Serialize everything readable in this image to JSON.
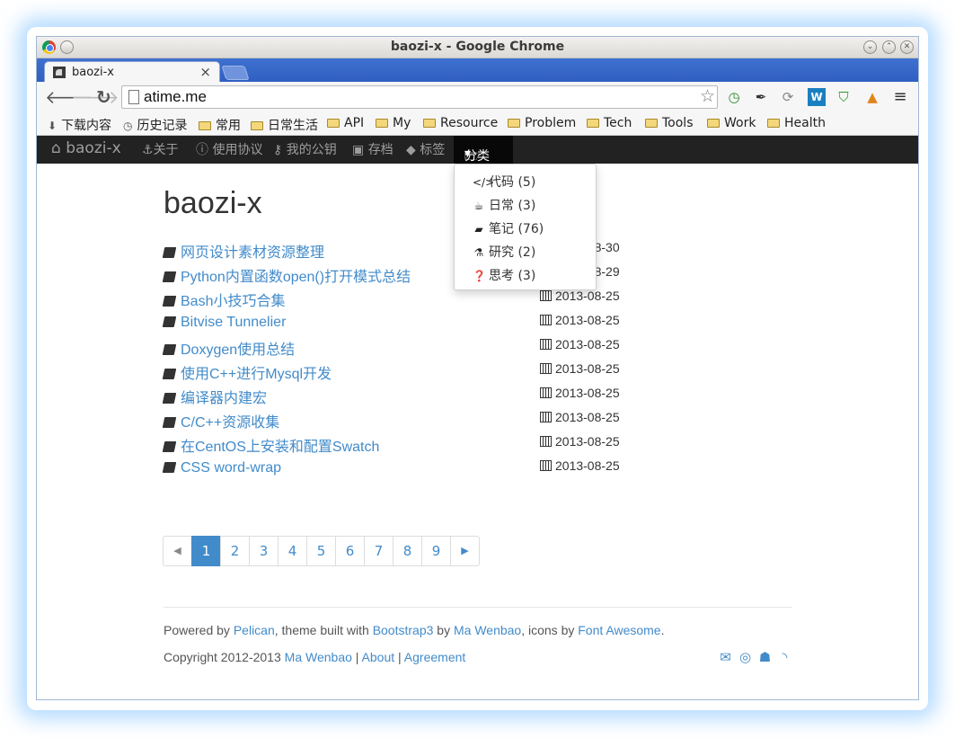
{
  "window": {
    "title": "baozi-x - Google Chrome"
  },
  "tab": {
    "label": "baozi-x",
    "close": "×"
  },
  "address_bar": {
    "url": "atime.me"
  },
  "bookmarks": [
    {
      "label": "下载内容",
      "icon": "download-icon"
    },
    {
      "label": "历史记录",
      "icon": "history-icon"
    },
    {
      "label": "常用",
      "icon": "folder-icon"
    },
    {
      "label": "日常生活",
      "icon": "folder-icon"
    },
    {
      "label": "API",
      "icon": "folder-icon"
    },
    {
      "label": "My",
      "icon": "folder-icon"
    },
    {
      "label": "Resource",
      "icon": "folder-icon"
    },
    {
      "label": "Problem",
      "icon": "folder-icon"
    },
    {
      "label": "Tech",
      "icon": "folder-icon"
    },
    {
      "label": "Tools",
      "icon": "folder-icon"
    },
    {
      "label": "Work",
      "icon": "folder-icon"
    },
    {
      "label": "Health",
      "icon": "folder-icon"
    }
  ],
  "site_nav": {
    "brand": "baozi-x",
    "items": [
      "关于",
      "使用协议",
      "我的公钥",
      "存档",
      "标签"
    ],
    "active": "分类"
  },
  "dropdown": [
    {
      "label": "代码 (5)",
      "icon": "code-icon"
    },
    {
      "label": "日常 (3)",
      "icon": "coffee-icon"
    },
    {
      "label": "笔记 (76)",
      "icon": "book-icon"
    },
    {
      "label": "研究 (2)",
      "icon": "beaker-icon"
    },
    {
      "label": "思考 (3)",
      "icon": "question-icon"
    }
  ],
  "main": {
    "title": "baozi-x",
    "posts": [
      {
        "title": "网页设计素材资源整理",
        "date": "2013-08-30"
      },
      {
        "title": "Python内置函数open()打开模式总结",
        "date": "2013-08-29"
      },
      {
        "title": "Bash小技巧合集",
        "date": "2013-08-25"
      },
      {
        "title": "Bitvise Tunnelier",
        "date": "2013-08-25"
      },
      {
        "title": "Doxygen使用总结",
        "date": "2013-08-25"
      },
      {
        "title": "使用C++进行Mysql开发",
        "date": "2013-08-25"
      },
      {
        "title": "编译器内建宏",
        "date": "2013-08-25"
      },
      {
        "title": "C/C++资源收集",
        "date": "2013-08-25"
      },
      {
        "title": "在CentOS上安装和配置Swatch",
        "date": "2013-08-25"
      },
      {
        "title": "CSS word-wrap",
        "date": "2013-08-25"
      }
    ],
    "pagination": {
      "pages": [
        "1",
        "2",
        "3",
        "4",
        "5",
        "6",
        "7",
        "8",
        "9"
      ],
      "current": "1"
    }
  },
  "footer": {
    "line1_prefix": "Powered by ",
    "pelican": "Pelican",
    "line1_mid": ", theme built with ",
    "bootstrap": "Bootstrap3",
    "line1_by": " by ",
    "author": "Ma Wenbao",
    "line1_icons": ", icons by ",
    "fontawesome": "Font Awesome",
    "line1_end": ".",
    "copyright_prefix": "Copyright 2012-2013 ",
    "copyright_name": "Ma Wenbao",
    "sep": " | ",
    "about": "About",
    "agreement": "Agreement"
  },
  "colors": {
    "link": "#428bca",
    "navbar": "#222222",
    "tabstrip": "#3f71d1"
  }
}
